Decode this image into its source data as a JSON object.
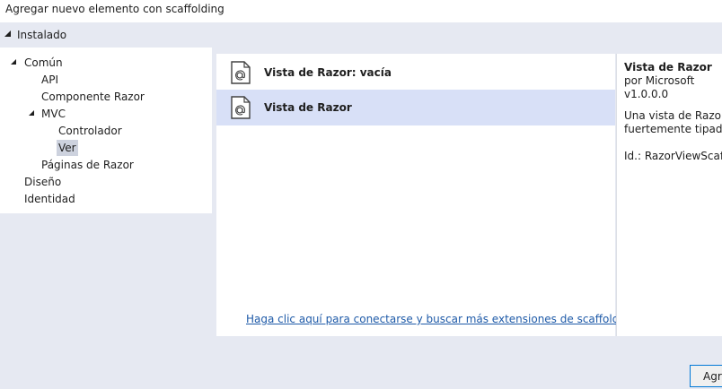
{
  "window": {
    "title": "Agregar nuevo elemento con scaffolding"
  },
  "installed": {
    "label": "Instalado"
  },
  "tree": {
    "comun": "Común",
    "api": "API",
    "componente_razor": "Componente Razor",
    "mvc": "MVC",
    "controlador": "Controlador",
    "ver": "Ver",
    "paginas_razor": "Páginas de Razor",
    "diseno": "Diseño",
    "identidad": "Identidad",
    "selected": "Ver"
  },
  "templates": [
    {
      "label": "Vista de Razor: vacía",
      "icon": "razor-file-icon",
      "selected": false
    },
    {
      "label": "Vista de Razor",
      "icon": "razor-file-icon",
      "selected": true
    }
  ],
  "online_link": "Haga clic aquí para conectarse y buscar más extensiones de scaffolding.",
  "details": {
    "name": "Vista de Razor",
    "author": "por Microsoft",
    "version": "v1.0.0.0",
    "description_line1": "Una vista de Razor co",
    "description_line2": "fuertemente tipado",
    "id": "Id.: RazorViewScaffol"
  },
  "buttons": {
    "add": "Agregar"
  },
  "colors": {
    "selection": "#d8e0f7",
    "link": "#1e5aa8",
    "accent": "#0078d7"
  }
}
